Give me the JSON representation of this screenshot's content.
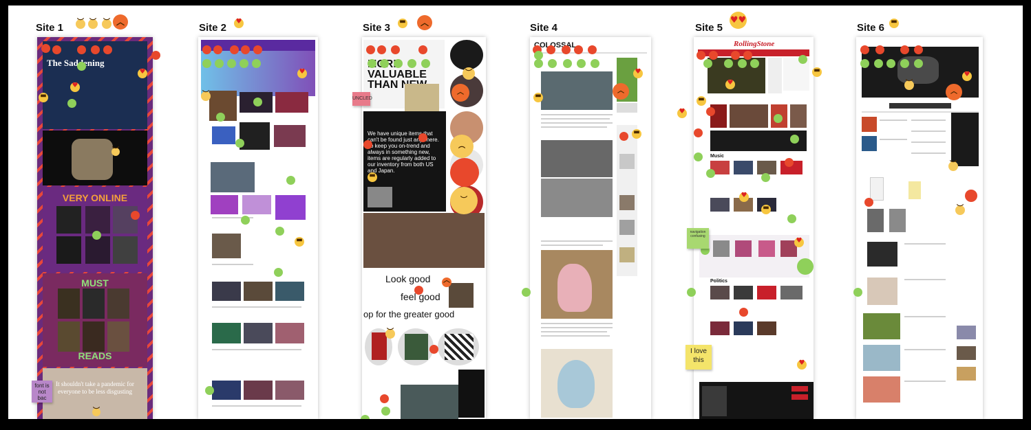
{
  "sites": [
    {
      "label": "Site 1"
    },
    {
      "label": "Site 2"
    },
    {
      "label": "Site 3"
    },
    {
      "label": "Site 4"
    },
    {
      "label": "Site 5"
    },
    {
      "label": "Site 6"
    }
  ],
  "site1": {
    "headline": "The Saddening",
    "very_online": "VERY ONLINE",
    "must": "MUST",
    "reads": "READS",
    "footer_quote": "It shouldn't take a pandemic for everyone to be less disgusting"
  },
  "site3": {
    "hero_text": "MORE VALUABLE THAN NEW",
    "dark_text": "We have unique items that can't be found just anywhere. To keep you on-trend and always in something new, items are regularly added to our inventory from both US and Japan.",
    "look_good": "Look good",
    "feel_good": "feel good",
    "shop": "op for the greater good"
  },
  "site4": {
    "logo": "COLOSSAL"
  },
  "site5": {
    "logo": "RollingStone",
    "section_music": "Music",
    "section_politics": "Politics"
  },
  "stickies": {
    "site1_note": "font is not bac",
    "site3_note": "UNCLED",
    "site5_love": "I love this",
    "site5_green": "navigation confusing"
  },
  "colors": {
    "red_dot": "#e8482c",
    "green_dot": "#8fd05a",
    "emoji_yellow": "#f7c640",
    "emoji_angry": "#ee6a2c"
  }
}
